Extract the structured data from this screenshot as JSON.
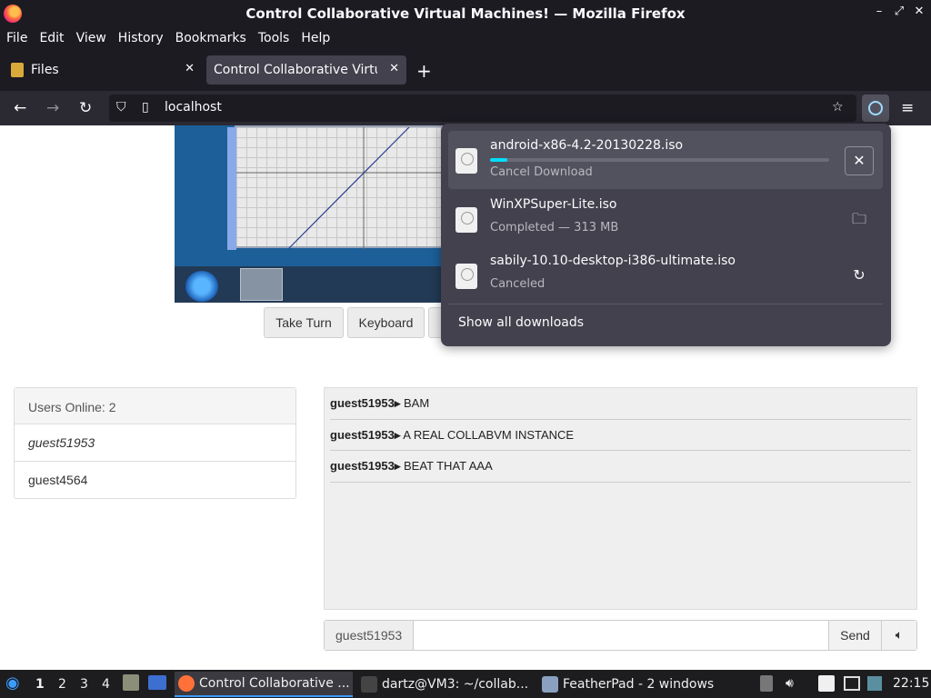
{
  "window": {
    "title": "Control Collaborative Virtual Machines! — Mozilla Firefox"
  },
  "menu": [
    "File",
    "Edit",
    "View",
    "History",
    "Bookmarks",
    "Tools",
    "Help"
  ],
  "tabs": [
    {
      "label": "Files",
      "active": false
    },
    {
      "label": "Control Collaborative Virtual Machines!",
      "active": true
    }
  ],
  "url": "localhost",
  "page": {
    "buttons": {
      "take_turn": "Take Turn",
      "keyboard": "Keyboard"
    },
    "users": {
      "header": "Users Online: 2",
      "list": [
        "guest51953",
        "guest4564"
      ]
    },
    "chat": {
      "messages": [
        {
          "user": "guest51953▸",
          "text": "BAM"
        },
        {
          "user": "guest51953▸",
          "text": "A REAL COLLABVM INSTANCE"
        },
        {
          "user": "guest51953▸",
          "text": "BEAT THAT AAA"
        }
      ],
      "nick": "guest51953",
      "send_label": "Send",
      "input_value": ""
    }
  },
  "downloads": {
    "items": [
      {
        "name": "android-x86-4.2-20130228.iso",
        "status": "Cancel Download",
        "progress": 0.05,
        "action": "cancel"
      },
      {
        "name": "WinXPSuper-Lite.iso",
        "status": "Completed — 313 MB",
        "action": "open-folder"
      },
      {
        "name": "sabily-10.10-desktop-i386-ultimate.iso",
        "status": "Canceled",
        "action": "retry"
      }
    ],
    "show_all": "Show all downloads"
  },
  "taskbar": {
    "workspaces": [
      "1",
      "2",
      "3",
      "4"
    ],
    "tasks": [
      {
        "label": "Control Collaborative ...",
        "active": true
      },
      {
        "label": "dartz@VM3: ~/collab...",
        "active": false
      },
      {
        "label": "FeatherPad - 2 windows",
        "active": false
      }
    ],
    "clock": "22:15"
  },
  "colors": {
    "accent": "#00ddff",
    "chrome_dark": "#1c1b22",
    "panel": "#42414d"
  }
}
